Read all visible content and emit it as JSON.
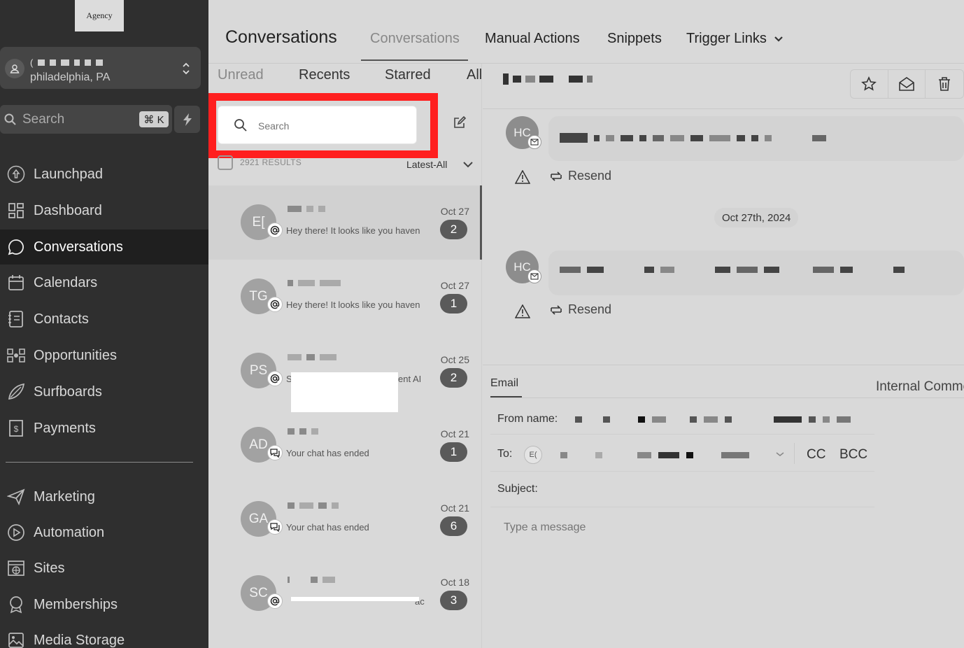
{
  "sidebar": {
    "logo_text": "Agency",
    "location": {
      "city": "philadelphia, PA"
    },
    "search": {
      "label": "Search",
      "shortcut": "⌘ K"
    },
    "nav": [
      {
        "label": "Launchpad",
        "icon": "rocket-icon"
      },
      {
        "label": "Dashboard",
        "icon": "grid-icon"
      },
      {
        "label": "Conversations",
        "icon": "chat-bubble-icon",
        "active": true
      },
      {
        "label": "Calendars",
        "icon": "calendar-icon"
      },
      {
        "label": "Contacts",
        "icon": "contacts-icon"
      },
      {
        "label": "Opportunities",
        "icon": "funnel-icon"
      },
      {
        "label": "Surfboards",
        "icon": "surfboard-icon"
      },
      {
        "label": "Payments",
        "icon": "receipt-icon"
      }
    ],
    "nav2": [
      {
        "label": "Marketing",
        "icon": "send-icon"
      },
      {
        "label": "Automation",
        "icon": "play-circle-icon"
      },
      {
        "label": "Sites",
        "icon": "globe-icon"
      },
      {
        "label": "Memberships",
        "icon": "badge-icon"
      },
      {
        "label": "Media Storage",
        "icon": "image-icon"
      }
    ]
  },
  "header": {
    "title": "Conversations",
    "tabs": [
      "Conversations",
      "Manual Actions",
      "Snippets",
      "Trigger Links"
    ]
  },
  "list": {
    "subtabs": [
      "Unread",
      "Recents",
      "Starred",
      "All"
    ],
    "search_placeholder": "Search",
    "results": "2921 RESULTS",
    "sort": "Latest-All",
    "items": [
      {
        "initials": "E[",
        "preview": "Hey there!  It looks like you haven",
        "date": "Oct 27",
        "count": "2",
        "channel": "mention"
      },
      {
        "initials": "TG",
        "preview": "Hey there!  It looks like you haven",
        "date": "Oct 27",
        "count": "1",
        "channel": "mention"
      },
      {
        "initials": "PS",
        "preview": "S",
        "preview_tail": "ent AI",
        "date": "Oct 25",
        "count": "2",
        "channel": "mention"
      },
      {
        "initials": "AD",
        "preview": "Your chat has ended",
        "date": "Oct 21",
        "count": "1",
        "channel": "chat"
      },
      {
        "initials": "GA",
        "preview": "Your chat has ended",
        "date": "Oct 21",
        "count": "6",
        "channel": "chat"
      },
      {
        "initials": "SC",
        "preview": "",
        "preview_tail": "ac",
        "date": "Oct 18",
        "count": "3",
        "channel": "mention"
      }
    ]
  },
  "thread": {
    "messages": [
      {
        "initials": "HC",
        "resend": "Resend"
      },
      {
        "initials": "HC",
        "resend": "Resend"
      }
    ],
    "date_divider": "Oct 27th, 2024"
  },
  "composer": {
    "tabs": {
      "email": "Email",
      "internal": "Internal Comment"
    },
    "from_label": "From name:",
    "to_label": "To:",
    "to_chip": "E(",
    "cc": "CC",
    "bcc": "BCC",
    "subject_label": "Subject:",
    "message_placeholder": "Type a message"
  }
}
